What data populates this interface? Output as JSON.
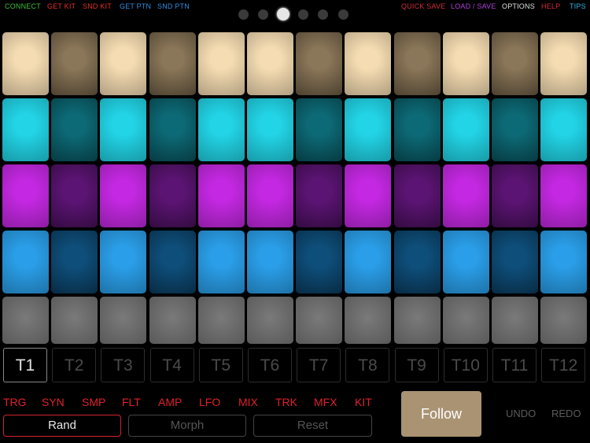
{
  "topbar": {
    "left": [
      {
        "label": "CONNECT",
        "color": "#3fbf3f"
      },
      {
        "label": "GET KIT",
        "color": "#e0302a"
      },
      {
        "label": "SND KIT",
        "color": "#e0302a"
      },
      {
        "label": "GET PTN",
        "color": "#2f8ce0"
      },
      {
        "label": "SND PTN",
        "color": "#2f8ce0"
      }
    ],
    "right": [
      {
        "label": "QUICK SAVE",
        "color": "#d42a3a"
      },
      {
        "label": "LOAD / SAVE",
        "color": "#b040d8"
      },
      {
        "label": "OPTIONS",
        "color": "#e0e0e0"
      },
      {
        "label": "HELP",
        "color": "#d42a3a"
      },
      {
        "label": "TIPS",
        "color": "#2fb0e0"
      }
    ]
  },
  "page_indicator": {
    "count": 6,
    "active": 3
  },
  "pad_rows": [
    {
      "name": "tan",
      "bright": "#f5dcb2",
      "dim": "#8a7658"
    },
    {
      "name": "cyan",
      "bright": "#22d4e6",
      "dim": "#0c6a76"
    },
    {
      "name": "magenta",
      "bright": "#c428e2",
      "dim": "#5c1474"
    },
    {
      "name": "blue",
      "bright": "#2a9ee8",
      "dim": "#0e4e7a"
    },
    {
      "name": "gray",
      "bright": "#6c6c6c",
      "dim": "#6c6c6c"
    }
  ],
  "pad_pattern": [
    1,
    0,
    1,
    0,
    1,
    1,
    0,
    1,
    0,
    1,
    0,
    1
  ],
  "tracks": [
    "T1",
    "T2",
    "T3",
    "T4",
    "T5",
    "T6",
    "T7",
    "T8",
    "T9",
    "T10",
    "T11",
    "T12"
  ],
  "selected_track": 0,
  "menu": [
    "TRG",
    "SYN",
    "SMP",
    "FLT",
    "AMP",
    "LFO",
    "MIX",
    "TRK",
    "MFX",
    "KIT"
  ],
  "buttons": {
    "rand": "Rand",
    "morph": "Morph",
    "reset": "Reset",
    "follow": "Follow",
    "undo": "UNDO",
    "redo": "REDO"
  }
}
